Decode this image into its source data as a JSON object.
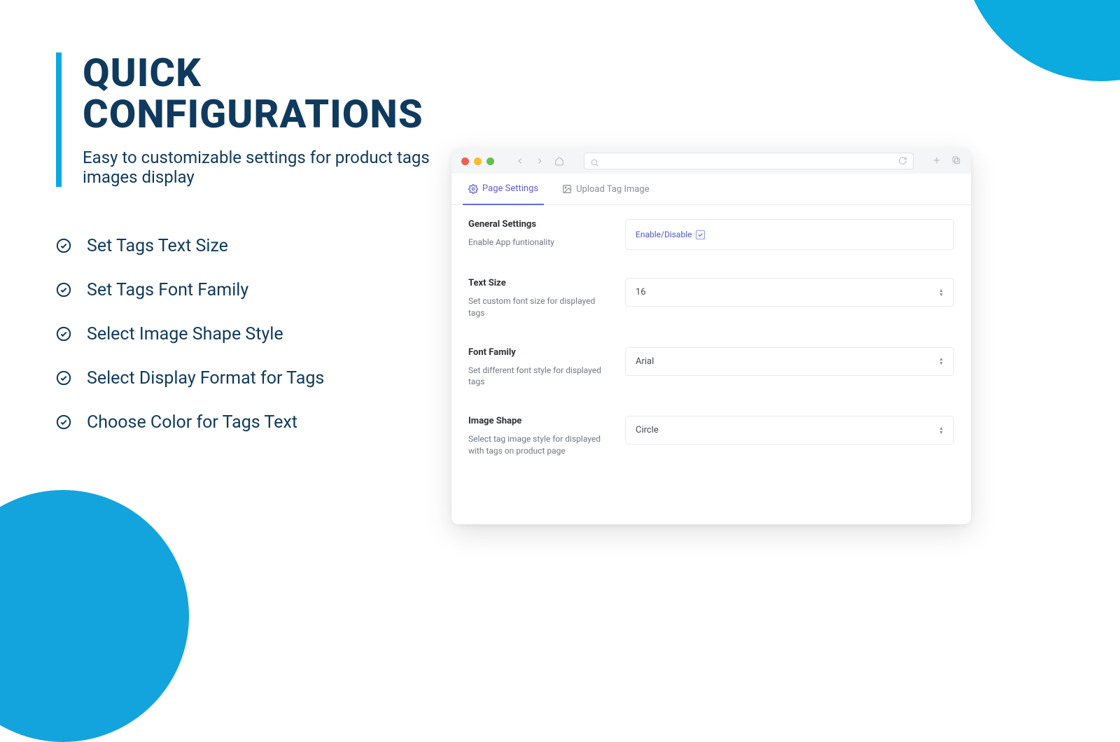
{
  "hero": {
    "title": "QUICK CONFIGURATIONS",
    "subtitle": "Easy to customizable settings for product tags images display"
  },
  "features": [
    "Set Tags Text Size",
    "Set Tags Font Family",
    "Select Image Shape Style",
    "Select Display Format  for Tags",
    "Choose Color for Tags Text"
  ],
  "tabs": {
    "page_settings": "Page Settings",
    "upload_tag_image": "Upload Tag Image"
  },
  "settings": {
    "general": {
      "title": "General Settings",
      "desc": "Enable App funtionality",
      "control_label": "Enable/Disable"
    },
    "text_size": {
      "title": "Text Size",
      "desc": "Set custom font size for displayed tags",
      "value": "16"
    },
    "font_family": {
      "title": "Font Family",
      "desc": "Set different font style for displayed tags",
      "value": "Arial"
    },
    "image_shape": {
      "title": "Image Shape",
      "desc": "Select tag image style for displayed with tags on product page",
      "value": "Circle"
    }
  },
  "colors": {
    "primary": "#0f3a5d",
    "accent": "#0baadf",
    "tab_active": "#6268e8"
  }
}
